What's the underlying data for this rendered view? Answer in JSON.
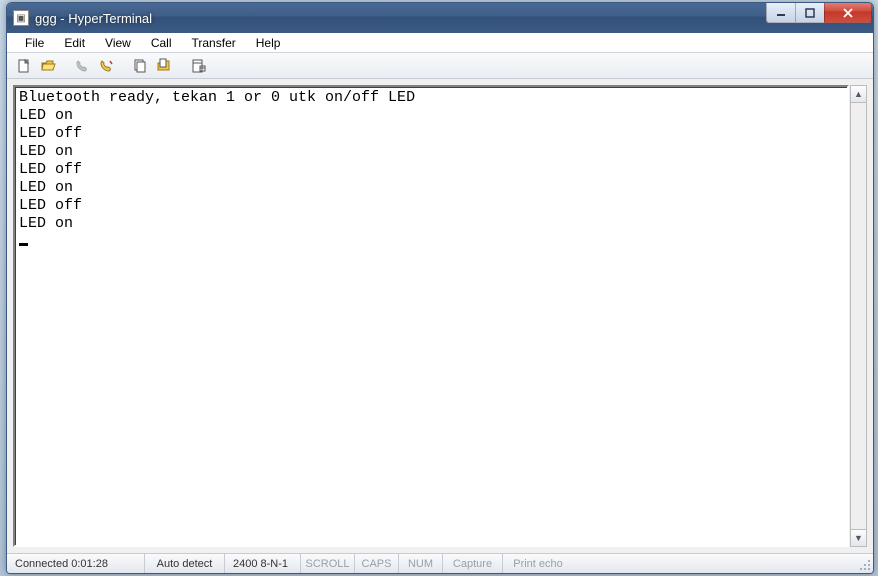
{
  "title": "ggg - HyperTerminal",
  "menu": {
    "file": "File",
    "edit": "Edit",
    "view": "View",
    "call": "Call",
    "transfer": "Transfer",
    "help": "Help"
  },
  "toolbar_icons": {
    "new": "new-file-icon",
    "open": "open-folder-icon",
    "call": "call-icon",
    "hangup": "hangup-icon",
    "send": "send-icon",
    "receive": "receive-icon",
    "properties": "properties-icon"
  },
  "terminal": {
    "lines": [
      "Bluetooth ready, tekan 1 or 0 utk on/off LED",
      "LED on",
      "LED off",
      "LED on",
      "LED off",
      "LED on",
      "LED off",
      "LED on"
    ]
  },
  "status": {
    "connection": "Connected 0:01:28",
    "detect": "Auto detect",
    "line_settings": "2400 8-N-1",
    "scroll": "SCROLL",
    "caps": "CAPS",
    "num": "NUM",
    "capture": "Capture",
    "print_echo": "Print echo"
  }
}
